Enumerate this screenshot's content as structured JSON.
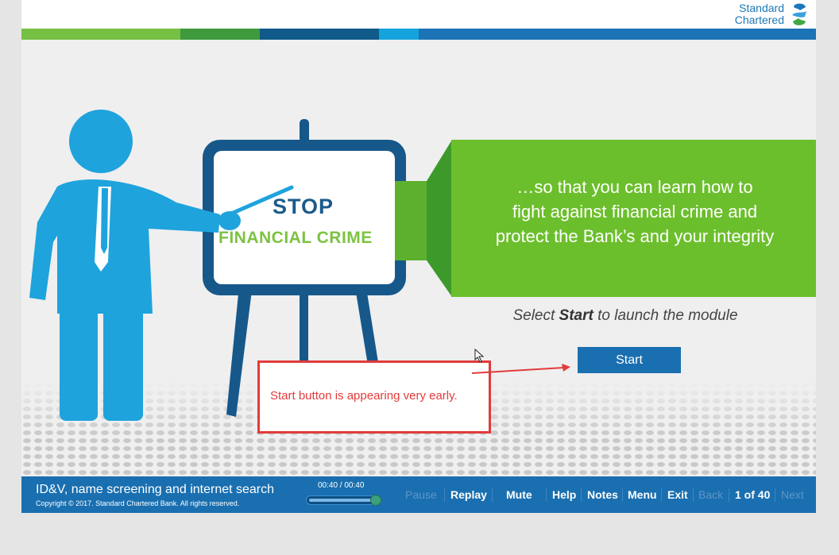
{
  "header": {
    "brand_line1": "Standard",
    "brand_line2": "Chartered",
    "logo_icon": "standard-chartered-logo-icon"
  },
  "color_bar": {
    "segments": [
      "#76c043",
      "#3e9a3c",
      "#0f5a88",
      "#14a3dc",
      "#1c73b5"
    ]
  },
  "slide": {
    "board_title": "STOP",
    "board_subtitle": "FINANCIAL CRIME",
    "banner_line1": "…so that you can learn how to",
    "banner_line2": "fight against financial crime and",
    "banner_line3": "protect the Bank’s and your integrity",
    "instruction_prefix": "Select ",
    "instruction_bold": "Start",
    "instruction_suffix": " to launch the module",
    "start_label": "Start"
  },
  "annotation": {
    "text": "Start button is appearing very early.",
    "color": "#e23b3b"
  },
  "footer": {
    "course_title": "ID&V, name screening and internet search",
    "copyright": "Copyright © 2017. Standard Chartered Bank. All rights reserved.",
    "timer": "00:40 / 00:40",
    "progress": 1.0,
    "controls": {
      "pause": "Pause",
      "replay": "Replay",
      "mute": "Mute",
      "help": "Help",
      "notes": "Notes",
      "menu": "Menu",
      "exit": "Exit",
      "back": "Back",
      "page": "1 of 40",
      "next": "Next"
    }
  },
  "colors": {
    "accent_blue": "#1a6fb0",
    "banner_green": "#6cbf2c",
    "figure_blue": "#1ea3dd"
  }
}
